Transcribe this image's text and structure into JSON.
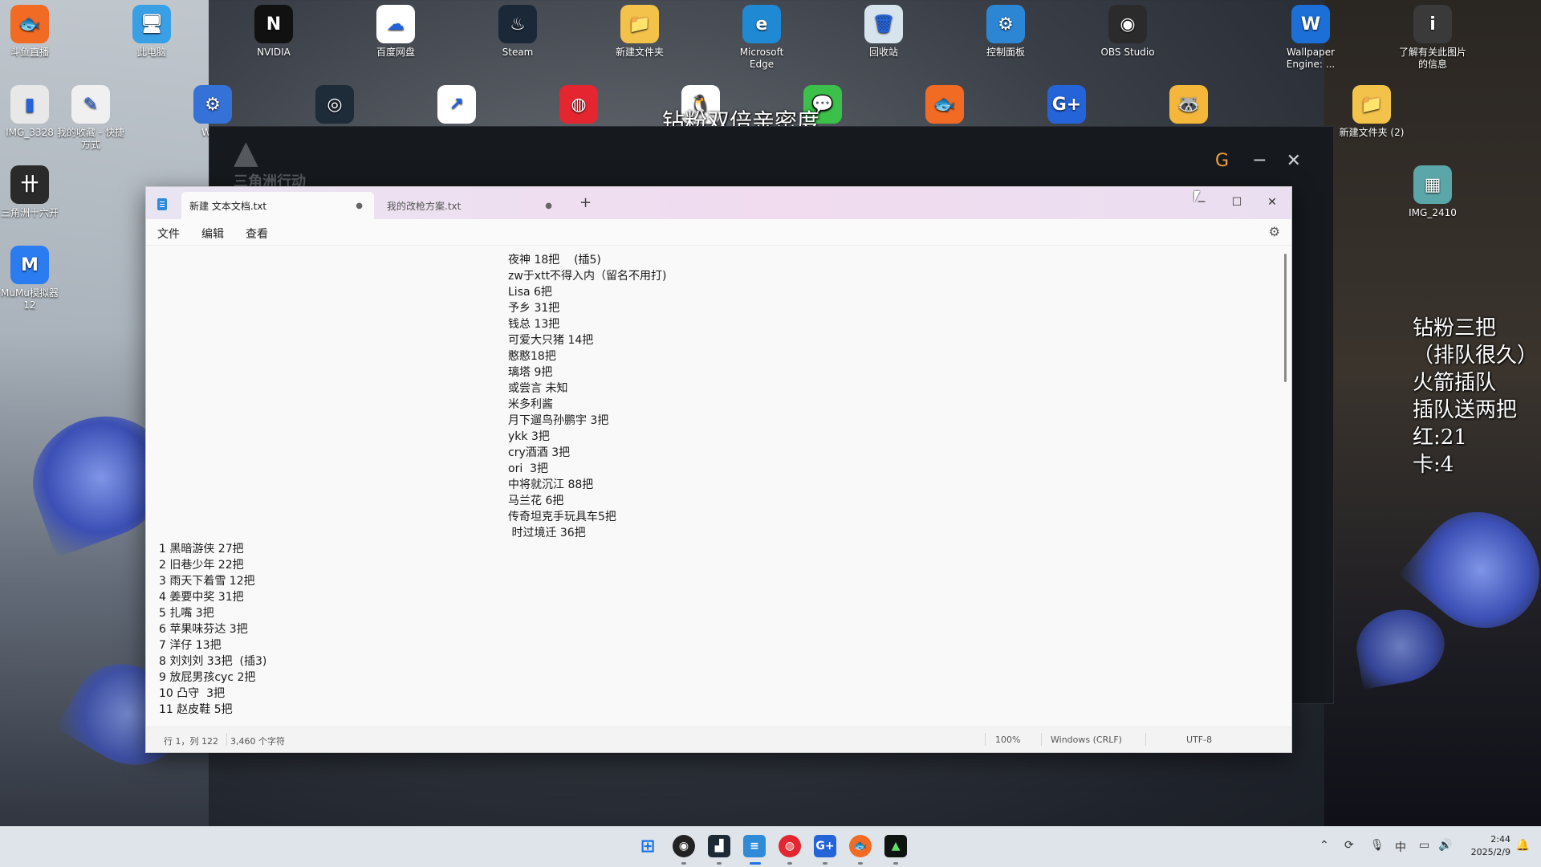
{
  "desktop": {
    "icons": [
      {
        "label": "斗鱼直播",
        "color": "#f26b24",
        "glyph": "🐟",
        "icon": "douyu-icon"
      },
      {
        "label": "此电脑",
        "color": "#3aa0e6",
        "glyph": "🖥",
        "icon": "computer-icon"
      },
      {
        "label": "NVIDIA",
        "color": "#111111",
        "glyph": "N",
        "icon": "nvidia-icon"
      },
      {
        "label": "百度网盘",
        "color": "#ffffff",
        "glyph": "☁",
        "icon": "baidu-netdisk-icon"
      },
      {
        "label": "Steam",
        "color": "#1b2838",
        "glyph": "♨",
        "icon": "steam-icon"
      },
      {
        "label": "新建文件夹",
        "color": "#f3c24a",
        "glyph": "📁",
        "icon": "folder-icon"
      },
      {
        "label": "Microsoft Edge",
        "color": "#1f8ad3",
        "glyph": "e",
        "icon": "edge-icon"
      },
      {
        "label": "回收站",
        "color": "#d7e4ee",
        "glyph": "🗑",
        "icon": "recycle-bin-icon"
      },
      {
        "label": "控制面板",
        "color": "#2d86d4",
        "glyph": "⚙",
        "icon": "control-panel-icon"
      },
      {
        "label": "OBS Studio",
        "color": "#2b2b2b",
        "glyph": "◉",
        "icon": "obs-icon"
      },
      {
        "label": "Wallpaper Engine: ...",
        "color": "#1c6fd6",
        "glyph": "W",
        "icon": "wallpaper-engine-icon"
      },
      {
        "label": "了解有关此图片的信息",
        "color": "#3a3a3a",
        "glyph": "i",
        "icon": "info-icon"
      },
      {
        "label": "IMG_3328",
        "color": "#e8e8e8",
        "glyph": "▮",
        "icon": "image-file-icon"
      },
      {
        "label": "我的收藏 - 快捷方式",
        "color": "#f0f0f0",
        "glyph": "✎",
        "icon": "shortcut-icon"
      },
      {
        "label": "Watt",
        "color": "#3572d8",
        "glyph": "⚙",
        "icon": "watt-toolkit-icon"
      },
      {
        "label": "",
        "color": "#1e2b38",
        "glyph": "◎",
        "icon": "app-ring-icon"
      },
      {
        "label": "",
        "color": "#ffffff",
        "glyph": "↗",
        "icon": "app-arrow-icon"
      },
      {
        "label": "",
        "color": "#e3262f",
        "glyph": "◍",
        "icon": "netease-music-icon"
      },
      {
        "label": "",
        "color": "#ffffff",
        "glyph": "🐧",
        "icon": "qq-icon"
      },
      {
        "label": "",
        "color": "#3bc14a",
        "glyph": "💬",
        "icon": "wechat-icon"
      },
      {
        "label": "",
        "color": "#f26b24",
        "glyph": "🐟",
        "icon": "douyu-icon-2"
      },
      {
        "label": "",
        "color": "#2563d8",
        "glyph": "G+",
        "icon": "gplus-icon"
      },
      {
        "label": "",
        "color": "#f4b73b",
        "glyph": "🦝",
        "icon": "raccoon-icon"
      },
      {
        "label": "新建文件夹 (2)",
        "color": "#f3c24a",
        "glyph": "📁",
        "icon": "folder-icon-2"
      },
      {
        "label": "IMG_2410",
        "color": "#5ba6a8",
        "glyph": "▦",
        "icon": "image-thumb-icon"
      },
      {
        "label": "三角洲十六开",
        "color": "#2a2a2a",
        "glyph": "卄",
        "icon": "game-icon"
      },
      {
        "label": "MuMu模拟器12",
        "color": "#2b7cf0",
        "glyph": "M",
        "icon": "mumu-icon"
      }
    ],
    "overlay_top": "钻粉双倍亲密度",
    "overlay_right": [
      "钻粉三把",
      "（排队很久）",
      "火箭插队",
      "插队送两把",
      "红:21",
      "卡:4"
    ]
  },
  "game_window": {
    "title": "三角洲行动"
  },
  "notepad": {
    "tabs": [
      {
        "label": "新建 文本文档.txt",
        "active": true
      },
      {
        "label": "我的改枪方案.txt",
        "active": false
      }
    ],
    "menu": [
      "文件",
      "编辑",
      "查看"
    ],
    "lines_center": [
      "夜神 18把    (插5)",
      "zw于xtt不得入内（留名不用打)",
      "Lisa 6把",
      "予乡 31把",
      "钱总 13把",
      "可爱大只猪 14把",
      "憨憨18把",
      "璃塔 9把",
      "或尝言 未知",
      "米多利酱",
      "月下遛鸟孙鹏宇 3把",
      "ykk 3把",
      "cry酒酒 3把",
      "ori  3把",
      "中将就沉江 88把",
      "马兰花 6把",
      "传奇坦克手玩具车5把",
      " 时过境迁 36把"
    ],
    "lines_left": [
      "1 黑暗游侠 27把",
      "2 旧巷少年 22把",
      "3 雨天下着雪 12把",
      "4 姜要中奖 31把",
      "5 扎嘴 3把",
      "6 苹果味芬达 3把",
      "7 洋仔 13把",
      "8 刘刘刘 33把  (插3)",
      "9 放屁男孩cyc 2把",
      "10 凸守  3把",
      "11 赵皮鞋 5把"
    ],
    "status": {
      "position": "行 1，列 122",
      "chars": "3,460 个字符",
      "zoom": "100%",
      "line_ending": "Windows (CRLF)",
      "encoding": "UTF-8"
    }
  },
  "taskbar": {
    "time": "2:44",
    "date": "2025/2/9",
    "ime": "中"
  }
}
